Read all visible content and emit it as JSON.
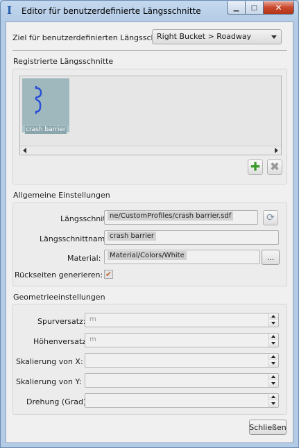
{
  "window": {
    "title": "Editor für benutzerdefinierte Längsschnitte",
    "controls": {
      "minimize": "▁",
      "maximize": "□",
      "close": "✕"
    }
  },
  "target": {
    "label": "Ziel für benutzerdefinierten Längsschni",
    "value": "Right Bucket > Roadway"
  },
  "registered": {
    "title": "Registrierte Längsschnitte",
    "items": [
      {
        "label": "crash barrier",
        "icon": "profile-curve-icon"
      }
    ],
    "add_icon": "plus-icon",
    "delete_icon": "delete-x-icon",
    "accent_add": "#3a9a2a",
    "accent_profile": "#2a4fd6"
  },
  "general": {
    "title": "Allgemeine Einstellungen",
    "profile_label": "Längsschnitt:",
    "profile_value": "ne/CustomProfiles/crash barrier.sdf",
    "refresh_icon": "refresh-icon",
    "name_label": "Längsschnittname:",
    "name_value": "crash barrier",
    "material_label": "Material:",
    "material_value": "Material/Colors/White",
    "browse_label": "...",
    "backfaces_label": "Rückseiten generieren:",
    "backfaces_checked": true
  },
  "geometry": {
    "title": "Geometrieeinstellungen",
    "fields": [
      {
        "label": "Spurversatz:",
        "value": "m"
      },
      {
        "label": "Höhenversatz:",
        "value": "m"
      },
      {
        "label": "Skalierung von X:",
        "value": ""
      },
      {
        "label": "Skalierung von Y:",
        "value": ""
      },
      {
        "label": "Drehung (Grad)",
        "value": ""
      }
    ]
  },
  "footer": {
    "close_label": "Schließen"
  }
}
